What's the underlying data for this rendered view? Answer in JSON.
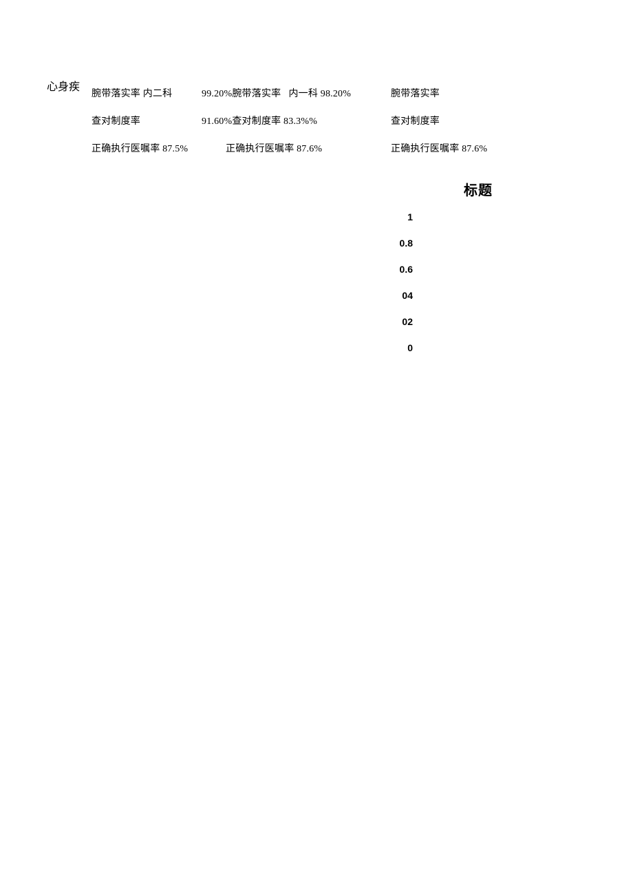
{
  "sidebar": {
    "label": "心身疾"
  },
  "rows": {
    "r1": {
      "c1": "腕带落实率 内二科",
      "c2": "99.20%腕带落实率   内一科 98.20%",
      "c3": "腕带落实率"
    },
    "r2": {
      "c1": "查对制度率",
      "c2": "91.60%查对制度率 83.3%%",
      "c3": "查对制度率"
    },
    "r3": {
      "c1": "正确执行医嘱率 87.5%",
      "c2": "正确执行医嘱率 87.6%",
      "c3": "正确执行医嘱率 87.6%"
    }
  },
  "chart_data": {
    "type": "bar",
    "title": "标题",
    "ylim": [
      0,
      1
    ],
    "yticks": [
      "1",
      "0.8",
      "0.6",
      "04",
      "02",
      "0"
    ],
    "categories": [],
    "values": []
  }
}
